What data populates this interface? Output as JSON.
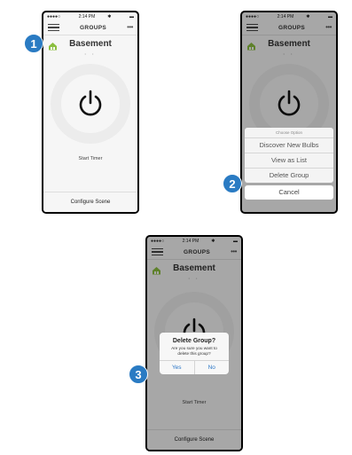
{
  "status_bar": {
    "carrier": "●●●●○",
    "time": "2:14 PM",
    "bluetooth": "✱",
    "battery": "▬"
  },
  "nav": {
    "title": "GROUPS",
    "menu_icon": "hamburger-icon",
    "more_icon": "more-dots-icon",
    "more_text": "•••"
  },
  "group": {
    "name": "Basement",
    "icon": "group-house-icon",
    "pager": "• •"
  },
  "power": {
    "icon": "power-icon"
  },
  "timer_label": "Start Timer",
  "configure_label": "Configure Scene",
  "action_sheet": {
    "header": "Choose Option",
    "items": [
      "Discover New Bulbs",
      "View as List",
      "Delete Group"
    ],
    "cancel": "Cancel"
  },
  "alert": {
    "title": "Delete Group?",
    "message": "Are you sure you want to delete this group?",
    "yes": "Yes",
    "no": "No"
  },
  "steps": [
    "1",
    "2",
    "3"
  ],
  "colors": {
    "badge": "#2a7bc3",
    "accent": "#2b76c6",
    "group_icon": "#8bbf3f"
  }
}
